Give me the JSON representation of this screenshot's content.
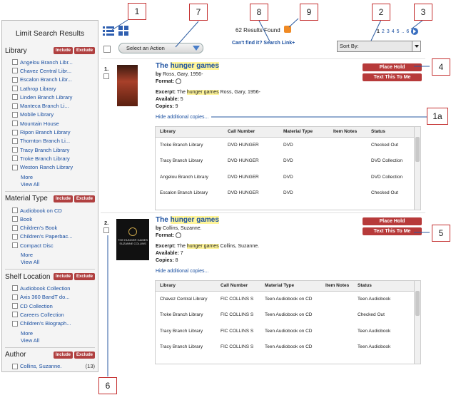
{
  "sidebar": {
    "title": "Limit Search Results",
    "include_label": "Include",
    "exclude_label": "Exclude",
    "more_label": "More",
    "view_all_label": "View All",
    "facets": [
      {
        "name": "Library",
        "items": [
          "Angelou Branch Libr...",
          "Chavez Central Libr...",
          "Escalon Branch Libr...",
          "Lathrop Library",
          "Linden Branch Library",
          "Manteca Branch Li...",
          "Mobile Library",
          "Mountain House",
          "Ripon Branch Library",
          "Thornton Branch Li...",
          "Tracy Branch Library",
          "Troke Branch Library",
          "Weston Ranch Library"
        ]
      },
      {
        "name": "Material Type",
        "items": [
          "Audiobook on CD",
          "Book",
          "Children's Book",
          "Children's Paperbac...",
          "Compact Disc"
        ]
      },
      {
        "name": "Shelf Location",
        "items": [
          "Audiobook Collection",
          "Axis 360 BandT do...",
          "CD Collection",
          "Careers Collection",
          "Children's Biograph..."
        ]
      },
      {
        "name": "Author",
        "items": [
          "Collins, Suzanne."
        ],
        "counts": [
          "(13)"
        ]
      }
    ]
  },
  "toolbar": {
    "action_select": "Select an Action",
    "results_found": "62 Results Found",
    "search_link": "Can't find it? Search Link+",
    "sort_select": "Sort By:",
    "pages": [
      "1",
      "2",
      "3",
      "4",
      "5",
      "..",
      "6"
    ]
  },
  "results": [
    {
      "num": "1.",
      "title_pre": "The ",
      "title_hl": "hunger games",
      "by_label": "by",
      "author": "Ross, Gary, 1956-",
      "format_label": "Format:",
      "excerpt_label": "Excerpt:",
      "excerpt_pre": "The ",
      "excerpt_hl": "hunger games",
      "excerpt_post": " Ross, Gary, 1956-",
      "available_label": "Available:",
      "available": "5",
      "copies_label": "Copies:",
      "copies": "9",
      "hide_link": "Hide additional copies...",
      "place_hold": "Place Hold",
      "text_me": "Text This To Me",
      "columns": [
        "Library",
        "Call Number",
        "Material Type",
        "Item Notes",
        "Status"
      ],
      "rows": [
        [
          "Troke Branch Library",
          "DVD HUNGER",
          "DVD",
          "",
          "Checked Out"
        ],
        [
          "Tracy Branch Library",
          "DVD HUNGER",
          "DVD",
          "",
          "DVD Collection"
        ],
        [
          "Angelou Branch Library",
          "DVD HUNGER",
          "DVD",
          "",
          "DVD Collection"
        ],
        [
          "Escalon Branch Library",
          "DVD HUNGER",
          "DVD",
          "",
          "Checked Out"
        ]
      ]
    },
    {
      "num": "2.",
      "title_pre": "The ",
      "title_hl": "hunger games",
      "by_label": "by",
      "author": "Collins, Suzanne.",
      "format_label": "Format:",
      "excerpt_label": "Excerpt:",
      "excerpt_pre": "The ",
      "excerpt_hl": "hunger games",
      "excerpt_post": " Collins, Suzanne.",
      "available_label": "Available:",
      "available": "7",
      "copies_label": "Copies:",
      "copies": "8",
      "hide_link": "Hide additional copies...",
      "place_hold": "Place Hold",
      "text_me": "Text This To Me",
      "columns": [
        "Library",
        "Call Number",
        "Material Type",
        "Item Notes",
        "Status"
      ],
      "rows": [
        [
          "Chavez Central Library",
          "FIC COLLINS S",
          "Teen Audiobook on CD",
          "",
          "Teen Audiobook"
        ],
        [
          "Troke Branch Library",
          "FIC COLLINS S",
          "Teen Audiobook on CD",
          "",
          "Checked Out"
        ],
        [
          "Tracy Branch Library",
          "FIC COLLINS S",
          "Teen Audiobook on CD",
          "",
          "Teen Audiobook"
        ],
        [
          "Tracy Branch Library",
          "FIC COLLINS S",
          "Teen Audiobook on CD",
          "",
          "Teen Audiobook"
        ]
      ]
    }
  ],
  "cover2_text": "THE HUNGER GAMES SUZANNE COLLINS",
  "callouts": [
    "1",
    "2",
    "3",
    "4",
    "1a",
    "5",
    "6",
    "7",
    "8",
    "9"
  ],
  "colors": {
    "accent_red": "#b73a3a",
    "link_blue": "#1a4fa0",
    "callout_border": "#c43030",
    "highlight": "#fff59a"
  }
}
